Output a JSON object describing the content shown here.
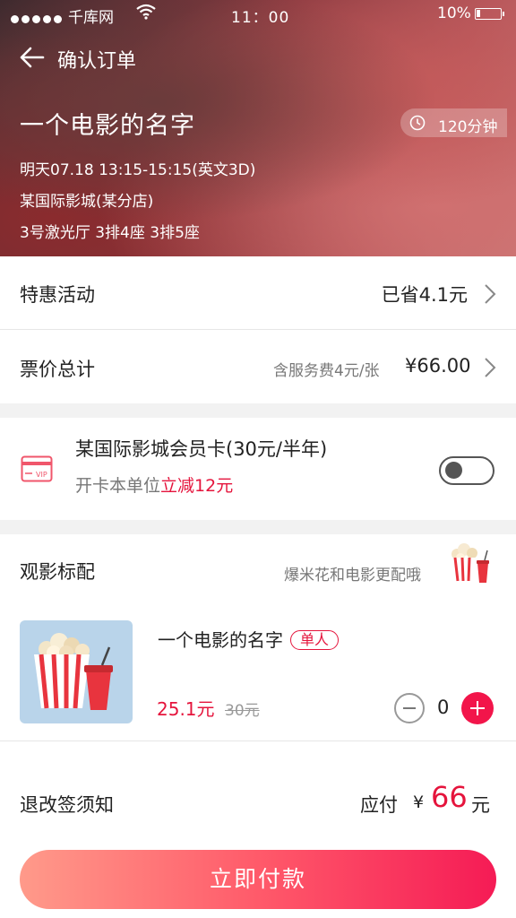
{
  "status_bar": {
    "carrier": "千库网",
    "time": "11：00",
    "battery": "10%"
  },
  "nav": {
    "title": "确认订单"
  },
  "movie": {
    "title": "一个电影的名字",
    "duration": "120分钟",
    "showtime": "明天07.18  13:15-15:15(英文3D)",
    "cinema": "某国际影城(某分店)",
    "seats": "3号激光厅  3排4座 3排5座"
  },
  "promo": {
    "label": "特惠活动",
    "value": "已省4.1元"
  },
  "ticket_total": {
    "label": "票价总计",
    "note": "含服务费4元/张",
    "value": "¥66.00"
  },
  "membership": {
    "title": "某国际影城会员卡(30元/半年)",
    "desc_prefix": "开卡本单位",
    "desc_highlight": "立减12元",
    "enabled": false
  },
  "snacks": {
    "label": "观影标配",
    "hint": "爆米花和电影更配哦",
    "item": {
      "name": "一个电影的名字",
      "tag": "单人",
      "price": "25.1元",
      "original_price": "30元",
      "quantity": "0"
    }
  },
  "refund": {
    "label": "退改签须知"
  },
  "payable": {
    "label": "应付",
    "currency": "¥",
    "amount": "66",
    "unit": "元"
  },
  "pay_button": {
    "label": "立即付款"
  },
  "colors": {
    "accent": "#e5143c",
    "toggle_off": "#555555"
  }
}
